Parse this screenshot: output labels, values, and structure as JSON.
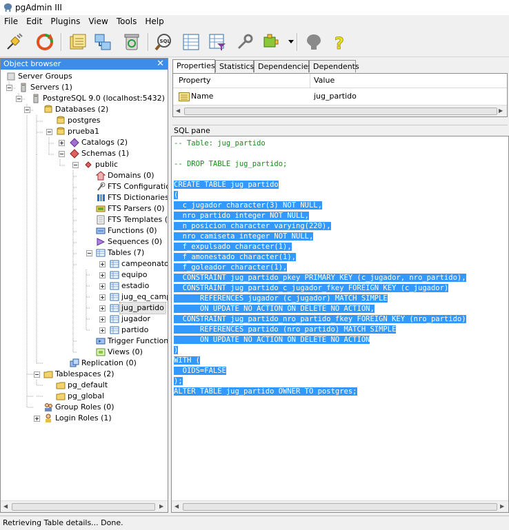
{
  "window": {
    "title": "pgAdmin III"
  },
  "menu": [
    "File",
    "Edit",
    "Plugins",
    "View",
    "Tools",
    "Help"
  ],
  "toolbar": {
    "icons": [
      "connect-icon",
      "refresh-icon",
      "properties-icon",
      "create-icon",
      "drop-icon",
      "sql-icon",
      "view-data-icon",
      "filtered-data-icon",
      "maintenance-icon",
      "plugins-icon",
      "hint-icon",
      "help-icon"
    ]
  },
  "object_browser": {
    "title": "Object browser",
    "nodes": [
      "Server Groups",
      "Servers (1)",
      "PostgreSQL 9.0 (localhost:5432)",
      "Databases (2)",
      "postgres",
      "prueba1",
      "Catalogs (2)",
      "Schemas (1)",
      "public",
      "Domains (0)",
      "FTS Configurations",
      "FTS Dictionaries (",
      "FTS Parsers (0)",
      "FTS Templates (0)",
      "Functions (0)",
      "Sequences (0)",
      "Tables (7)",
      "campeonato",
      "equipo",
      "estadio",
      "jug_eq_camp",
      "jug_partido",
      "jugador",
      "partido",
      "Trigger Functions",
      "Views (0)",
      "Replication (0)",
      "Tablespaces (2)",
      "pg_default",
      "pg_global",
      "Group Roles (0)",
      "Login Roles (1)"
    ]
  },
  "tabs": [
    "Properties",
    "Statistics",
    "Dependencies",
    "Dependents"
  ],
  "properties": {
    "col_property": "Property",
    "col_value": "Value",
    "rows": [
      {
        "property": "Name",
        "value": "jug_partido"
      }
    ]
  },
  "sql_pane": {
    "label": "SQL pane",
    "lines": [
      "-- Table: jug_partido",
      "",
      "-- DROP TABLE jug_partido;",
      "",
      "CREATE TABLE jug_partido",
      "(",
      "  c_jugador character(3) NOT NULL,",
      "  nro_partido integer NOT NULL,",
      "  n_posicion character varying(220),",
      "  nro_camiseta integer NOT NULL,",
      "  f_expulsado character(1),",
      "  f_amonestado character(1),",
      "  f_goleador character(1),",
      "  CONSTRAINT jug_partido_pkey PRIMARY KEY (c_jugador, nro_partido),",
      "  CONSTRAINT jug_partido_c_jugador_fkey FOREIGN KEY (c_jugador)",
      "      REFERENCES jugador (c_jugador) MATCH SIMPLE",
      "      ON UPDATE NO ACTION ON DELETE NO ACTION,",
      "  CONSTRAINT jug_partido_nro_partido_fkey FOREIGN KEY (nro_partido)",
      "      REFERENCES partido (nro_partido) MATCH SIMPLE",
      "      ON UPDATE NO ACTION ON DELETE NO ACTION",
      ")",
      "WITH (",
      "  OIDS=FALSE",
      ");",
      "ALTER TABLE jug_partido OWNER TO postgres;"
    ],
    "highlight_from_line": 4
  },
  "status": {
    "text": "Retrieving Table details... Done."
  },
  "colors": {
    "selection": "#3399ff",
    "comment": "#1a8a1a",
    "header": "#3c8ce8"
  }
}
